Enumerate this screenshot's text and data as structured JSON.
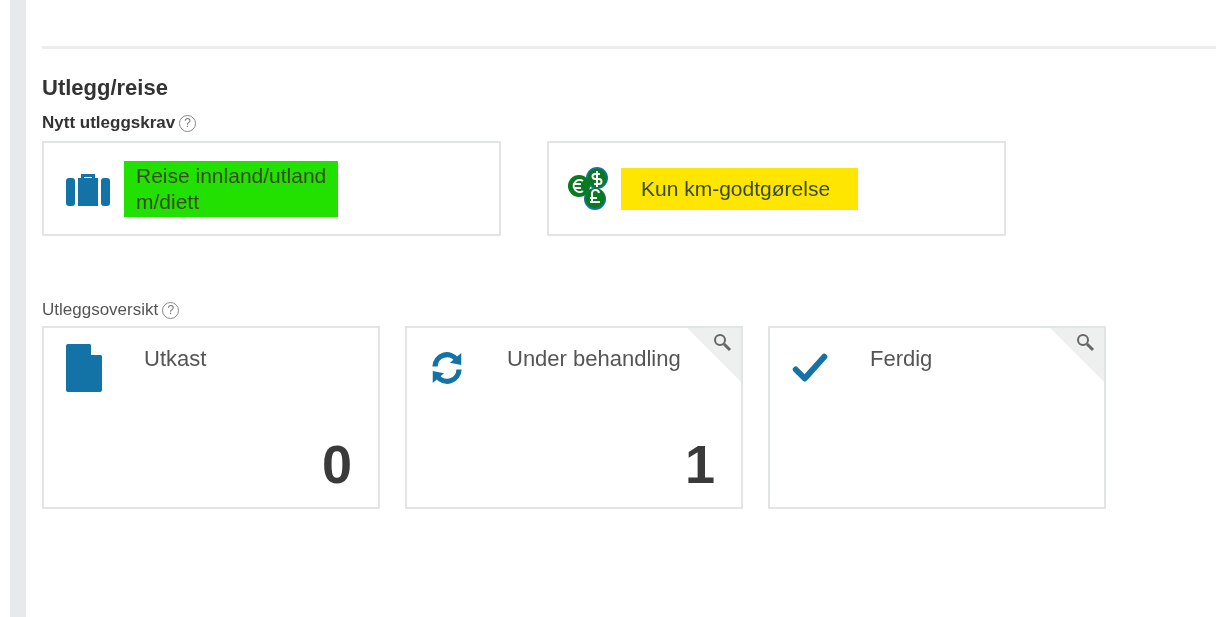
{
  "title": "Utlegg/reise",
  "new_claim": {
    "label": "Nytt utleggskrav",
    "help": "?",
    "options": [
      {
        "kind": "travel",
        "label_lines": [
          "Reise innland/utland",
          "m/diett"
        ],
        "color": "#22e000"
      },
      {
        "kind": "mileage",
        "label_lines": [
          "Kun km-godtgørelse"
        ],
        "color": "#ffe600"
      }
    ]
  },
  "overview": {
    "label": "Utleggsoversikt",
    "help": "?",
    "cards": [
      {
        "kind": "draft",
        "label": "Utkast",
        "count": "0",
        "search": false
      },
      {
        "kind": "processing",
        "label": "Under behandling",
        "count": "1",
        "search": true
      },
      {
        "kind": "done",
        "label": "Ferdig",
        "search": true
      }
    ]
  }
}
